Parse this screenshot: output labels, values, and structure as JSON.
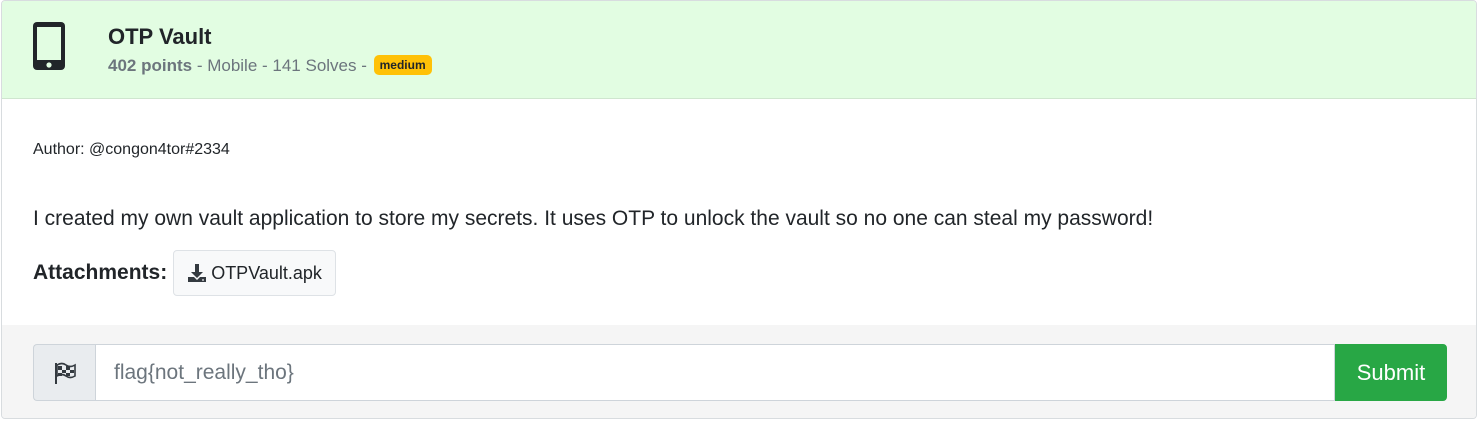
{
  "challenge": {
    "title": "OTP Vault",
    "points": "402 points",
    "meta_rest": " - Mobile - 141 Solves - ",
    "difficulty": "medium",
    "icon": "mobile-phone-icon"
  },
  "body": {
    "author": "Author: @congon4tor#2334",
    "description": "I created my own vault application to store my secrets. It uses OTP to unlock the vault so no one can steal my password!",
    "attachments_label": "Attachments:",
    "attachment_file": "OTPVault.apk",
    "attachment_icon": "download-icon"
  },
  "footer": {
    "flag_icon": "checkered-flag-icon",
    "input_placeholder": "flag{not_really_tho}",
    "input_value": "",
    "submit_label": "Submit"
  },
  "colors": {
    "header_bg": "#e2fde2",
    "badge": "#ffc107",
    "submit": "#28a745"
  }
}
